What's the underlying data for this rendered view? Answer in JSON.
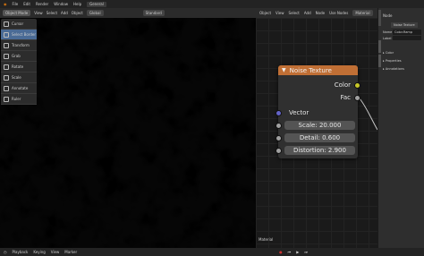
{
  "topbar": {
    "menus": [
      "File",
      "Edit",
      "Render",
      "Window",
      "Help"
    ],
    "workspace_tab": "General"
  },
  "viewport": {
    "mode": "Object Mode",
    "menus": [
      "View",
      "Select",
      "Add",
      "Object"
    ],
    "transform": "Global",
    "shading": "Standard",
    "noise_colors": {
      "dark": "#060606",
      "light": "#f0f0f0",
      "mid": "#8a8a8a"
    }
  },
  "toolbar": {
    "tools": [
      "Cursor",
      "Select Border",
      "Transform",
      "Grab",
      "Rotate",
      "Scale",
      "Annotate",
      "Ruler"
    ]
  },
  "node_editor": {
    "header": [
      "Object",
      "View",
      "Select",
      "Add",
      "Node",
      "Use Nodes",
      "Material"
    ],
    "footer_label": "Material",
    "node": {
      "title": "Noise Texture",
      "outputs": [
        "Color",
        "Fac"
      ],
      "input_vector": "Vector",
      "fields": [
        {
          "label": "Scale:",
          "value": "20.000"
        },
        {
          "label": "Detail:",
          "value": "0.600"
        },
        {
          "label": "Distortion:",
          "value": "2.900"
        }
      ],
      "colors": {
        "header": "#c06f35",
        "socket_color": "#c7c729",
        "socket_float": "#a1a1a1",
        "socket_vector": "#6363c7"
      }
    }
  },
  "sidebar": {
    "title": "Node",
    "name_field": "Noise Texture",
    "rows": [
      {
        "label": "Name",
        "value": "Color.Ramp"
      },
      {
        "label": "Label",
        "value": ""
      }
    ],
    "sections": [
      "Color",
      "Properties",
      "Annotations"
    ]
  },
  "bottombar": {
    "items": [
      "Playback",
      "Keying",
      "View",
      "Marker"
    ]
  }
}
